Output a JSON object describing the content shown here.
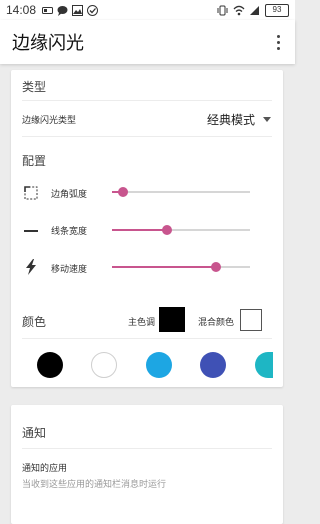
{
  "status_bar": {
    "time": "14:08",
    "battery": "93"
  },
  "app_bar": {
    "title": "边缘闪光"
  },
  "type_section": {
    "title": "类型",
    "row_label": "边缘闪光类型",
    "dropdown_value": "经典模式"
  },
  "config_section": {
    "title": "配置",
    "sliders": [
      {
        "label": "边角弧度",
        "value": 0.08
      },
      {
        "label": "线条宽度",
        "value": 0.4
      },
      {
        "label": "移动速度",
        "value": 0.75
      }
    ]
  },
  "color_section": {
    "title": "颜色",
    "main_tone_label": "主色调",
    "main_tone_color": "#000000",
    "mixed_color_label": "混合颜色",
    "mixed_color": "#ffffff",
    "palette": [
      "#000000",
      "#ffffff",
      "#1da6e3",
      "#3f51b5",
      "#1eb6c4"
    ]
  },
  "notify_section": {
    "title": "通知",
    "row_label": "通知的应用",
    "row_description": "当收到这些应用的通知栏消息时运行"
  },
  "accent_color": "#c8558e"
}
